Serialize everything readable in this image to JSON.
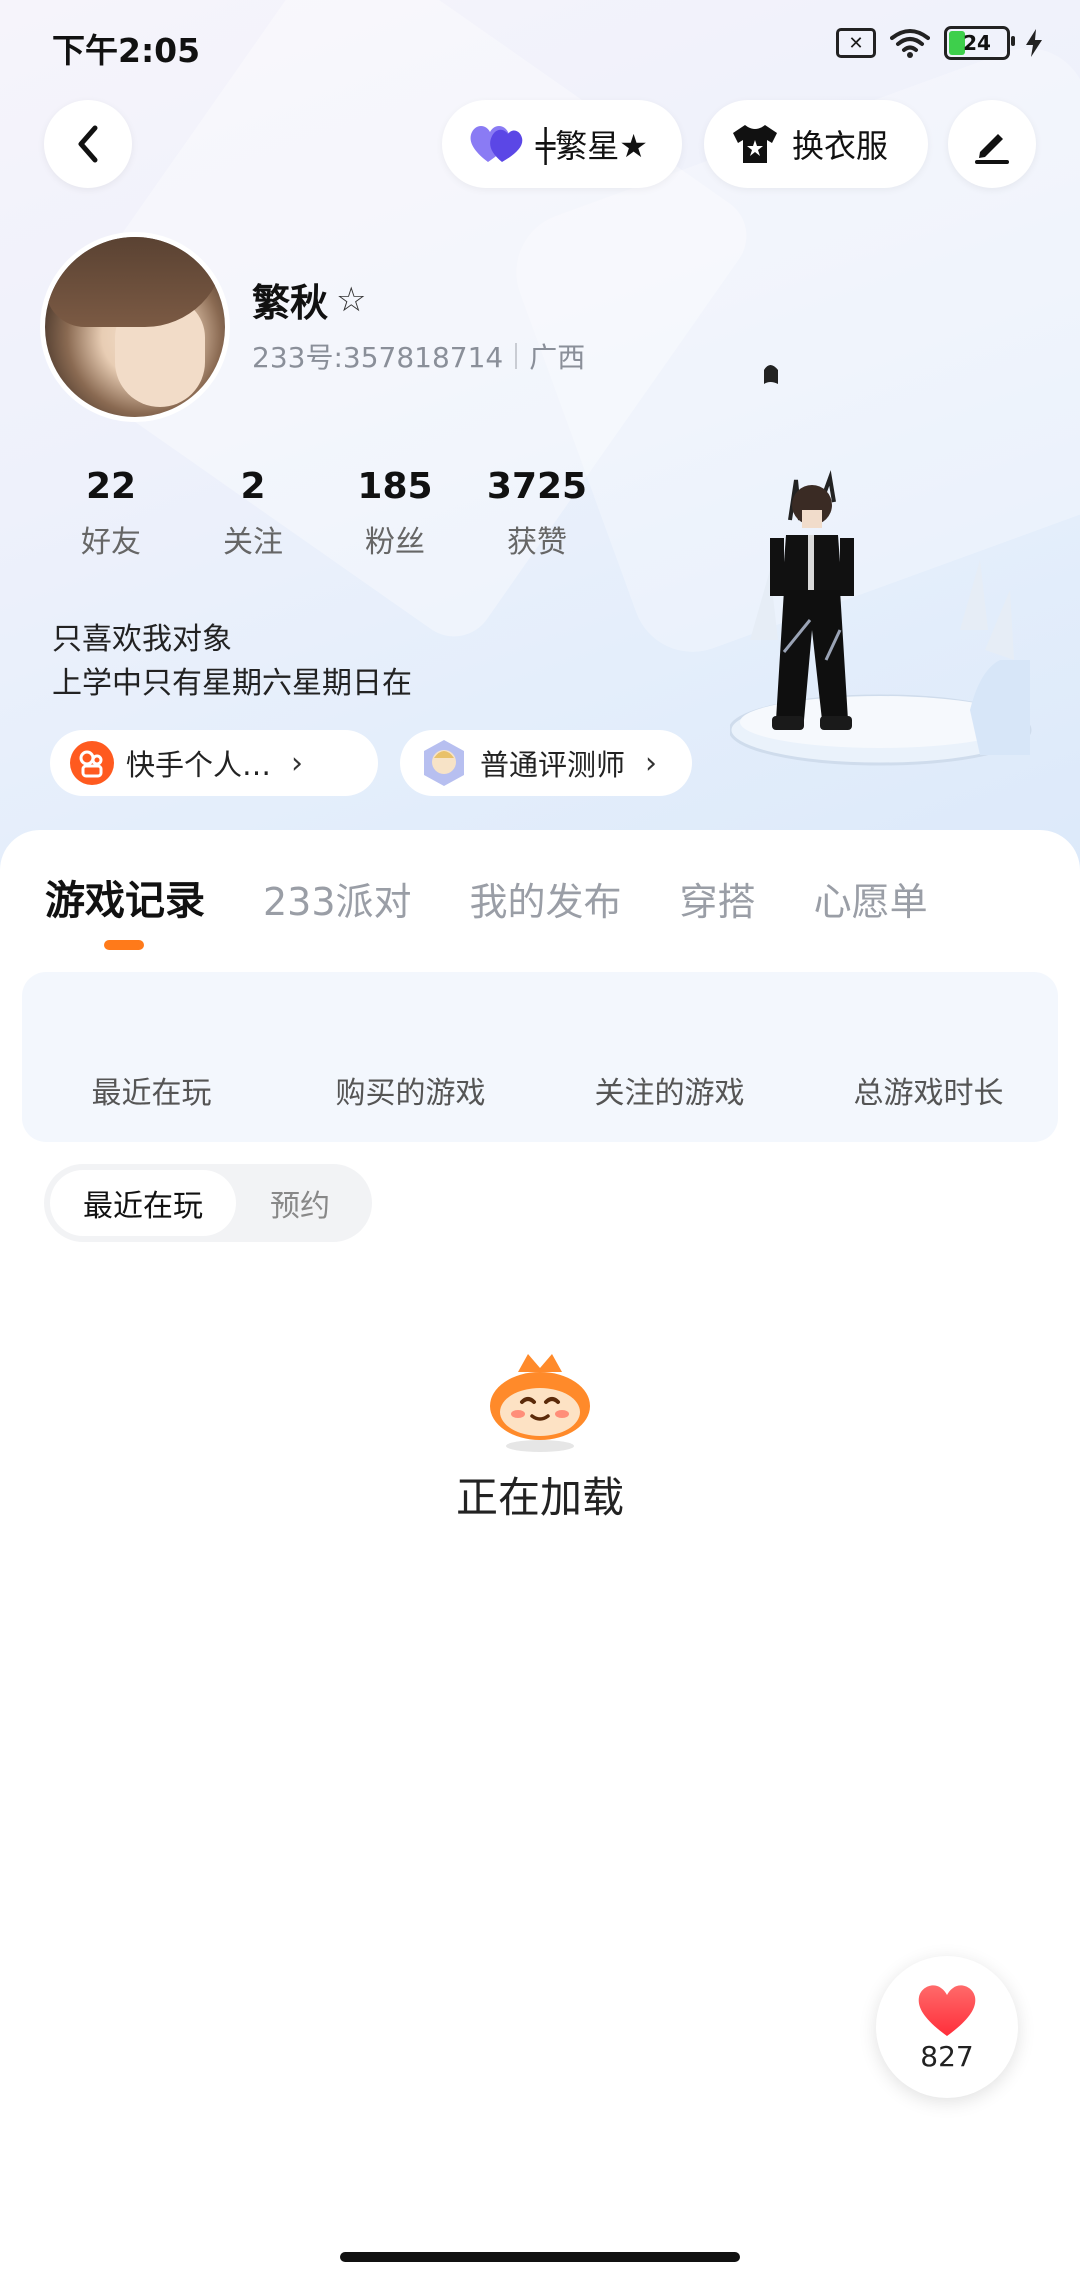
{
  "status_bar": {
    "time": "下午2:05",
    "battery_level": "24",
    "sim_icon": "sim-x-icon",
    "wifi_icon": "wifi-icon",
    "charging_icon": "bolt-icon"
  },
  "header": {
    "back_icon": "chevron-left-icon",
    "star_button_label": "╪繁星★",
    "outfit_button_label": "换衣服",
    "edit_icon": "pen-icon"
  },
  "profile": {
    "nickname": "繁秋",
    "nickname_mark": "☆",
    "user_id": "233号:357818714",
    "region": "广西",
    "stats": [
      {
        "value": "22",
        "label": "好友"
      },
      {
        "value": "2",
        "label": "关注"
      },
      {
        "value": "185",
        "label": "粉丝"
      },
      {
        "value": "3725",
        "label": "获赞"
      }
    ],
    "bio_line1": "只喜欢我对象",
    "bio_line2": "上学中只有星期六星期日在",
    "badges": [
      {
        "label": "快手个人…",
        "icon": "kuaishou-icon"
      },
      {
        "label": "普通评测师",
        "icon": "reviewer-badge-icon"
      }
    ]
  },
  "tabs": [
    "游戏记录",
    "233派对",
    "我的发布",
    "穿搭",
    "心愿单"
  ],
  "active_tab_index": 0,
  "summary": [
    "最近在玩",
    "购买的游戏",
    "关注的游戏",
    "总游戏时长"
  ],
  "segment": {
    "options": [
      "最近在玩",
      "预约"
    ],
    "selected": "最近在玩"
  },
  "loading_text": "正在加载",
  "like": {
    "count": "827",
    "icon": "heart-icon"
  },
  "colors": {
    "accent": "#ff7a1a",
    "heart": "#ff3b3b",
    "purple_heart": "#6f5cf0"
  }
}
